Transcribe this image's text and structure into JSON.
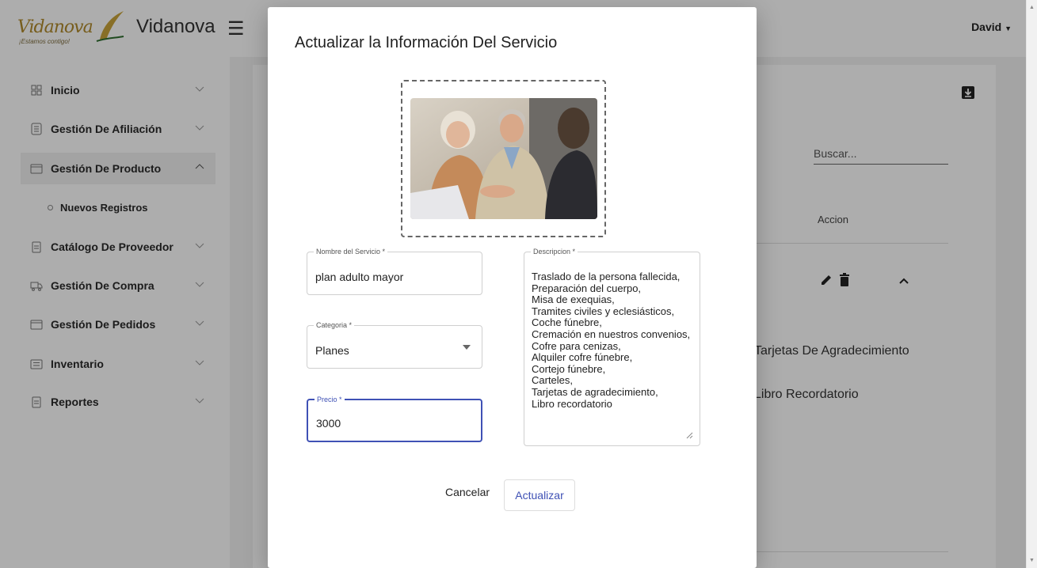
{
  "header": {
    "logo_script": "Vidanova",
    "logo_tagline": "¡Estamos contigo!",
    "brand": "Vidanova",
    "user": "David"
  },
  "sidebar": {
    "items": [
      {
        "label": "Inicio",
        "icon": "grid-icon"
      },
      {
        "label": "Gestión De Afiliación",
        "icon": "document-list-icon"
      },
      {
        "label": "Gestión De Producto",
        "icon": "calendar-icon"
      },
      {
        "label": "Catálogo De Proveedor",
        "icon": "document-icon"
      },
      {
        "label": "Gestión De Compra",
        "icon": "truck-icon"
      },
      {
        "label": "Gestión De Pedidos",
        "icon": "calendar-icon"
      },
      {
        "label": "Inventario",
        "icon": "list-icon"
      },
      {
        "label": "Reportes",
        "icon": "document-icon"
      }
    ],
    "sub_item": "Nuevos Registros"
  },
  "background": {
    "search_placeholder": "Buscar...",
    "column_accion": "Accion",
    "item1": "Tarjetas De Agradecimiento",
    "item2": "Libro Recordatorio"
  },
  "modal": {
    "title": "Actualizar la Información Del Servicio",
    "nombre": {
      "label": "Nombre del Servicio *",
      "value": "plan adulto mayor"
    },
    "categoria": {
      "label": "Categoria *",
      "value": "Planes"
    },
    "precio": {
      "label": "Precio *",
      "value": "3000"
    },
    "descripcion": {
      "label": "Descripcion *",
      "value": "Traslado de la persona fallecida,\nPreparación del cuerpo,\nMisa de exequias,\nTramites civiles y eclesiásticos,\nCoche fúnebre,\nCremación en nuestros convenios,\nCofre para cenizas,\nAlquiler cofre fúnebre,\nCortejo fúnebre,\nCarteles,\nTarjetas de agradecimiento,\nLibro recordatorio"
    },
    "cancel_label": "Cancelar",
    "update_label": "Actualizar"
  },
  "colors": {
    "accent": "#3f51b5",
    "brand_gold": "#b08a2c"
  }
}
